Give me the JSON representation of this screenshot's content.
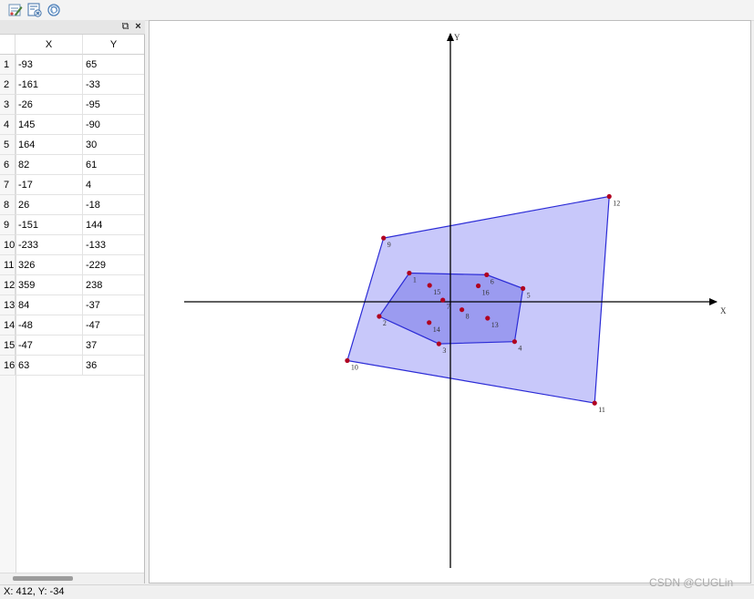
{
  "toolbar": {
    "buttons": [
      {
        "name": "edit-points-icon"
      },
      {
        "name": "clear-table-icon"
      },
      {
        "name": "convex-hull-icon"
      }
    ]
  },
  "panel": {
    "float_label": "⧉",
    "close_label": "×",
    "col_x": "X",
    "col_y": "Y",
    "rows": [
      {
        "n": "1",
        "x": "-93",
        "y": "65"
      },
      {
        "n": "2",
        "x": "-161",
        "y": "-33"
      },
      {
        "n": "3",
        "x": "-26",
        "y": "-95"
      },
      {
        "n": "4",
        "x": "145",
        "y": "-90"
      },
      {
        "n": "5",
        "x": "164",
        "y": "30"
      },
      {
        "n": "6",
        "x": "82",
        "y": "61"
      },
      {
        "n": "7",
        "x": "-17",
        "y": "4"
      },
      {
        "n": "8",
        "x": "26",
        "y": "-18"
      },
      {
        "n": "9",
        "x": "-151",
        "y": "144"
      },
      {
        "n": "10",
        "x": "-233",
        "y": "-133"
      },
      {
        "n": "11",
        "x": "326",
        "y": "-229"
      },
      {
        "n": "12",
        "x": "359",
        "y": "238"
      },
      {
        "n": "13",
        "x": "84",
        "y": "-37"
      },
      {
        "n": "14",
        "x": "-48",
        "y": "-47"
      },
      {
        "n": "15",
        "x": "-47",
        "y": "37"
      },
      {
        "n": "16",
        "x": "63",
        "y": "36"
      }
    ]
  },
  "plot": {
    "axis_x_label": "X",
    "axis_y_label": "Y",
    "outer_hull": [
      9,
      12,
      11,
      10
    ],
    "inner_hull": [
      1,
      6,
      5,
      4,
      3,
      2
    ],
    "outer_fill": "#c8c8fa",
    "inner_fill": "#9b9bf0",
    "hull_stroke": "#2b2bd6",
    "point_color": "#b00020"
  },
  "status": {
    "coords": "X: 412, Y: -34"
  },
  "watermark": "CSDN @CUGLin"
}
